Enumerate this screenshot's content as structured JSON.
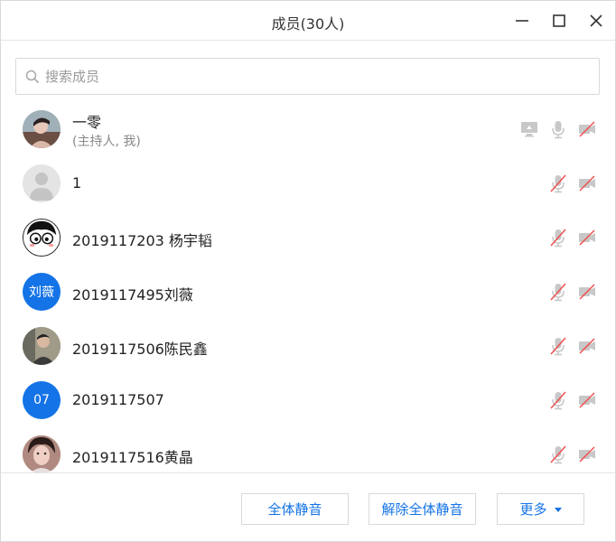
{
  "window": {
    "title": "成员(30人)"
  },
  "search": {
    "placeholder": "搜索成员"
  },
  "members": [
    {
      "name": "一零",
      "subtitle": "(主持人, 我)",
      "avatar_type": "photo",
      "avatar_text": ""
    },
    {
      "name": "1",
      "avatar_type": "default",
      "avatar_text": ""
    },
    {
      "name": "2019117203 杨宇韬",
      "avatar_type": "cartoon",
      "avatar_text": ""
    },
    {
      "name": "2019117495刘薇",
      "avatar_type": "text",
      "avatar_text": "刘薇"
    },
    {
      "name": "2019117506陈民鑫",
      "avatar_type": "photo",
      "avatar_text": ""
    },
    {
      "name": "2019117507",
      "avatar_type": "text",
      "avatar_text": "07"
    },
    {
      "name": "2019117516黄晶",
      "avatar_type": "photo",
      "avatar_text": ""
    }
  ],
  "footer": {
    "mute_all_label": "全体静音",
    "unmute_all_label": "解除全体静音",
    "more_label": "更多"
  },
  "colors": {
    "accent": "#1473e6",
    "icon_gray": "#c8c8c8",
    "muted_red": "#f05050"
  }
}
